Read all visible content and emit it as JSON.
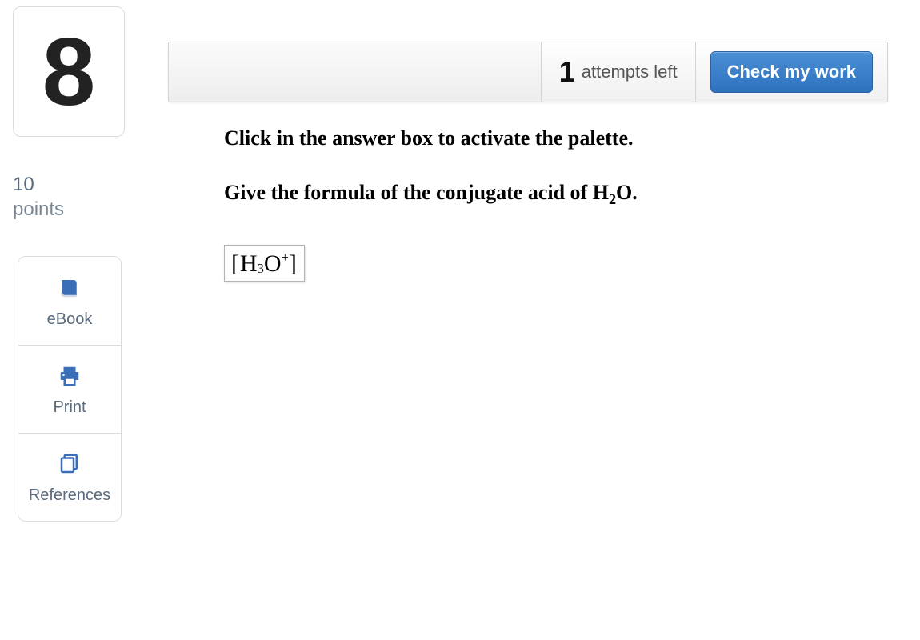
{
  "question": {
    "number": "8",
    "points_value": "10",
    "points_label": "points"
  },
  "tools": {
    "ebook_label": "eBook",
    "print_label": "Print",
    "references_label": "References"
  },
  "topbar": {
    "attempts_count": "1",
    "attempts_label": "attempts left",
    "check_label": "Check my work"
  },
  "body": {
    "instruction": "Click in the answer box to activate the palette.",
    "prompt_pre": "Give the formula of the conjugate acid of H",
    "prompt_sub": "2",
    "prompt_post": "O."
  },
  "answer": {
    "open": "[",
    "base1": "H",
    "sub": "3",
    "base2": "O",
    "sup": "+",
    "close": "]"
  }
}
